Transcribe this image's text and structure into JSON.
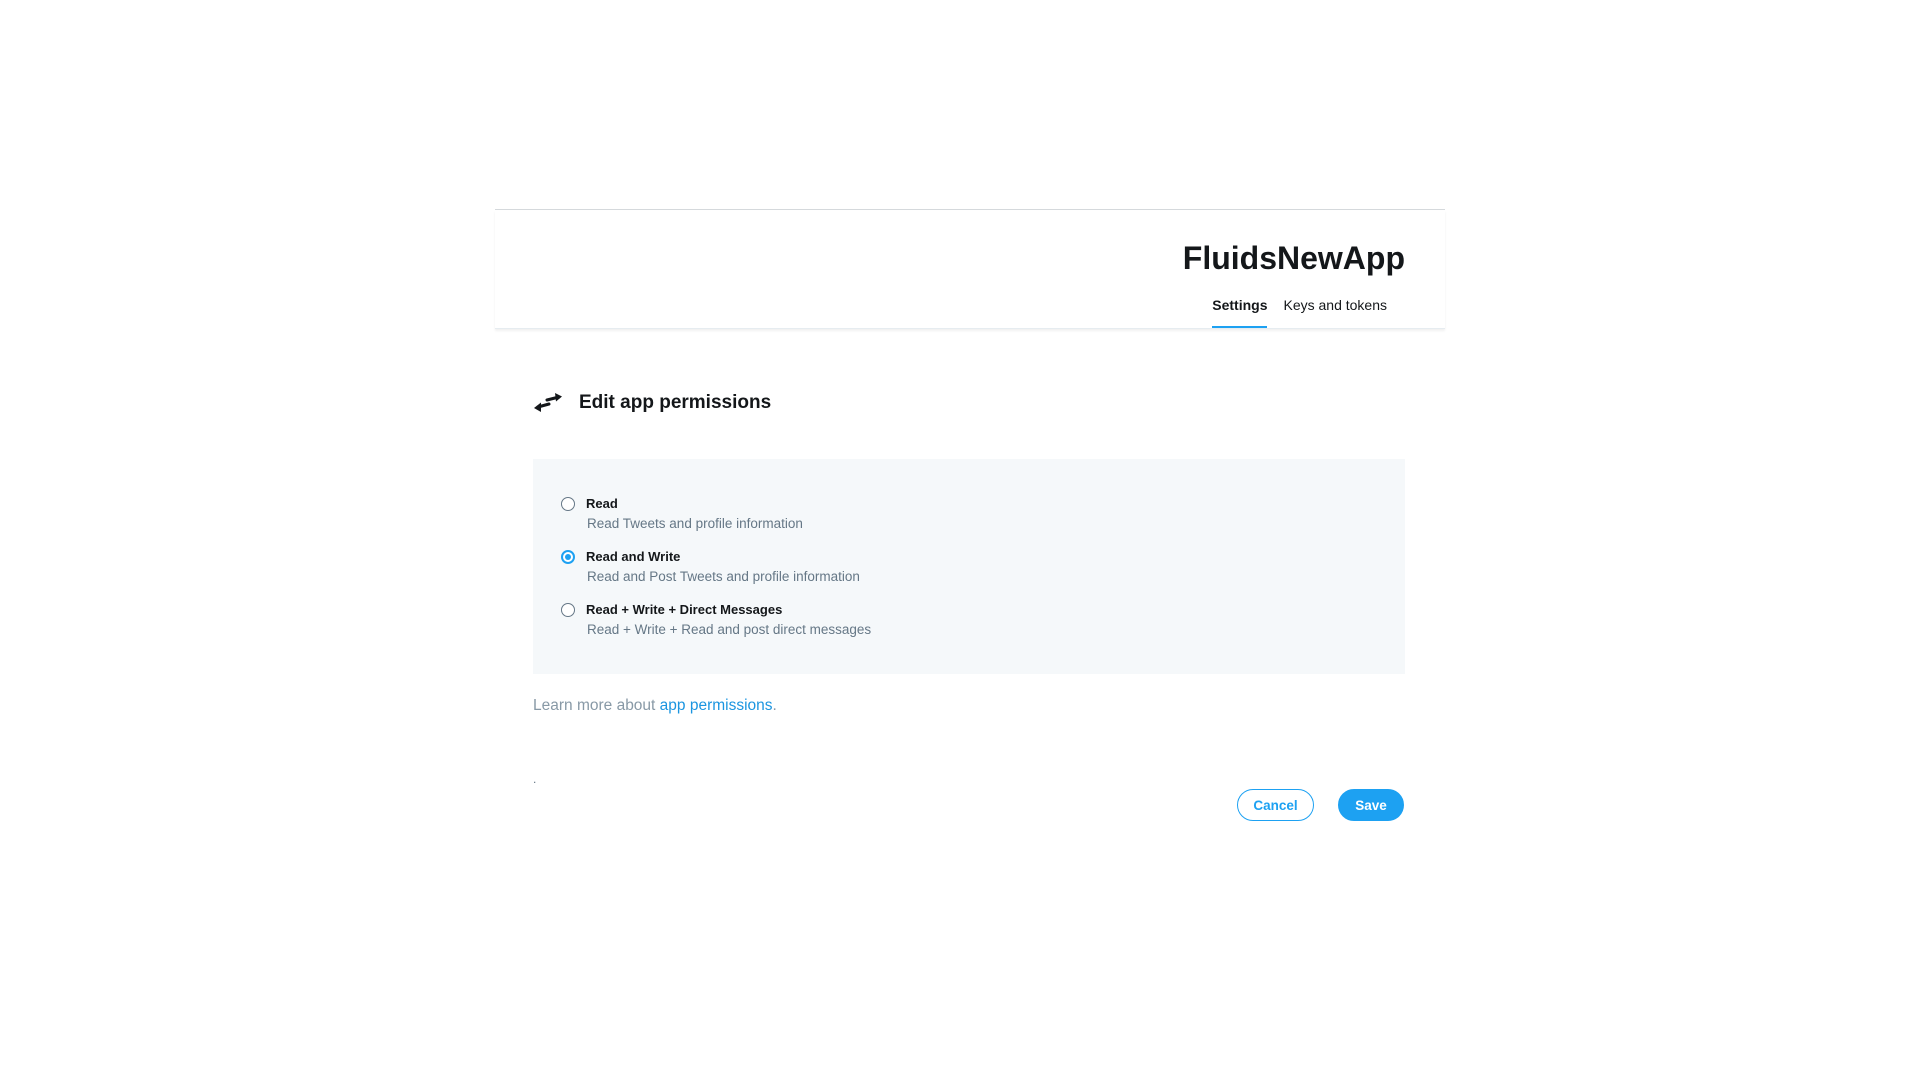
{
  "app": {
    "name": "FluidsNewApp",
    "tabs": [
      {
        "label": "Settings",
        "active": true
      },
      {
        "label": "Keys and tokens",
        "active": false
      }
    ]
  },
  "section": {
    "icon": "swap-arrows-icon",
    "title": "Edit app permissions"
  },
  "permissions": {
    "options": [
      {
        "label": "Read",
        "description": "Read Tweets and profile information",
        "selected": false
      },
      {
        "label": "Read and Write",
        "description": "Read and Post Tweets and profile information",
        "selected": true
      },
      {
        "label": "Read + Write + Direct Messages",
        "description": "Read + Write + Read and post direct messages",
        "selected": false
      }
    ]
  },
  "learn_more": {
    "prefix": "Learn more about ",
    "link_text": "app permissions",
    "suffix": "."
  },
  "stray_text": ".",
  "actions": {
    "cancel_label": "Cancel",
    "save_label": "Save"
  },
  "colors": {
    "accent": "#1da1f2",
    "link": "#1b95e0",
    "panel_bg": "#f5f8fa",
    "text_primary": "#14171a",
    "text_secondary": "#657786"
  }
}
